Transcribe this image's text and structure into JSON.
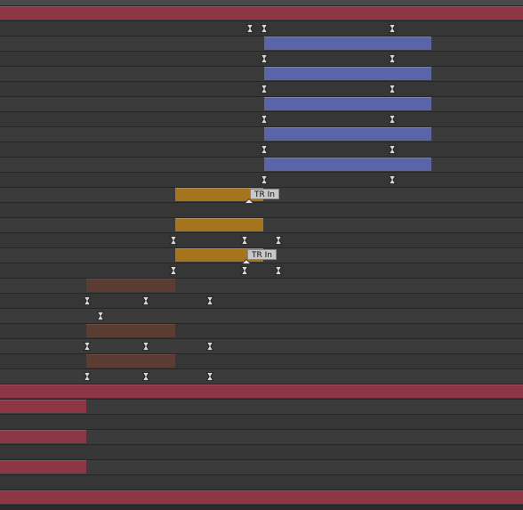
{
  "timeline": {
    "markers": [
      {
        "label": "TR In"
      },
      {
        "label": "TR In"
      }
    ],
    "colors": {
      "layer_red": "#8d3646",
      "layer_blue": "#5a64a8",
      "layer_gold": "#a7741e",
      "layer_brown": "#5a3c33",
      "row_bg": "#3b3b3b",
      "keyframe": "#d8d8d8"
    },
    "icons": {
      "keyframe": "hourglass-keyframe-icon",
      "marker": "comp-marker-icon"
    }
  }
}
